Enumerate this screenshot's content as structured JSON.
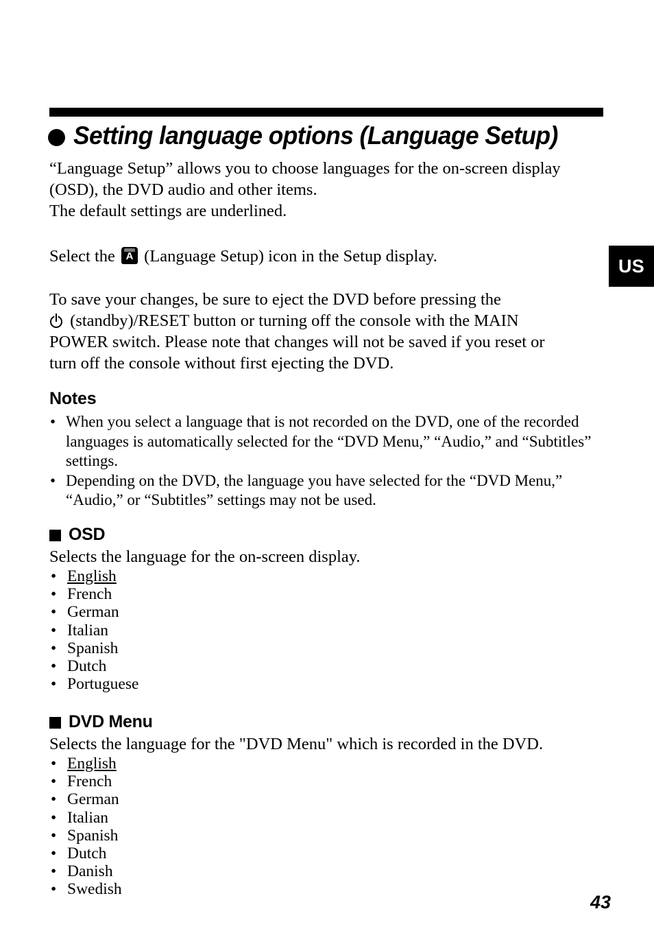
{
  "page": {
    "number": "43",
    "region_tab": "US"
  },
  "title": {
    "bullet": "filled-circle",
    "text": "Setting language options (Language Setup)"
  },
  "intro": {
    "line1": "“Language Setup” allows you to choose languages for the on-screen display",
    "line2": "(OSD), the DVD audio and other items.",
    "line3": "The default settings are underlined."
  },
  "select_instruction": {
    "before_icon": "Select the ",
    "icon_letter": "A",
    "icon_name": "language-setup-icon",
    "after_icon": " (Language Setup) icon in the Setup display."
  },
  "save_warning": {
    "line1": "To save your changes, be sure to eject the DVD before pressing the",
    "line2_glyph": "standby-power-symbol",
    "line2": " (standby)/RESET button or turning off the console with the MAIN",
    "line3": "POWER switch. Please note that changes will not be saved if you reset or",
    "line4": "turn off the console without first ejecting the DVD."
  },
  "notes": {
    "heading": "Notes",
    "bullet": "•",
    "items": [
      "When you select a language that is not recorded on the DVD, one of the recorded languages is automatically selected for the “DVD Menu,” “Audio,” and “Subtitles” settings.",
      "Depending on the DVD, the language you have selected for the “DVD Menu,” “Audio,” or “Subtitles” settings may not be used."
    ]
  },
  "sections": [
    {
      "heading": "OSD",
      "description": "Selects the language for the on-screen display.",
      "bullet": "•",
      "options": [
        {
          "label": "English",
          "default": true
        },
        {
          "label": "French",
          "default": false
        },
        {
          "label": "German",
          "default": false
        },
        {
          "label": "Italian",
          "default": false
        },
        {
          "label": "Spanish",
          "default": false
        },
        {
          "label": "Dutch",
          "default": false
        },
        {
          "label": "Portuguese",
          "default": false
        }
      ]
    },
    {
      "heading": "DVD Menu",
      "description": "Selects the language for the \"DVD Menu\" which is recorded in the DVD.",
      "bullet": "•",
      "options": [
        {
          "label": "English",
          "default": true
        },
        {
          "label": "French",
          "default": false
        },
        {
          "label": "German",
          "default": false
        },
        {
          "label": "Italian",
          "default": false
        },
        {
          "label": "Spanish",
          "default": false
        },
        {
          "label": "Dutch",
          "default": false
        },
        {
          "label": "Danish",
          "default": false
        },
        {
          "label": "Swedish",
          "default": false
        }
      ]
    }
  ],
  "colors": {
    "ink": "#000000",
    "paper": "#ffffff",
    "icon_cap": "#7a7a7a"
  }
}
